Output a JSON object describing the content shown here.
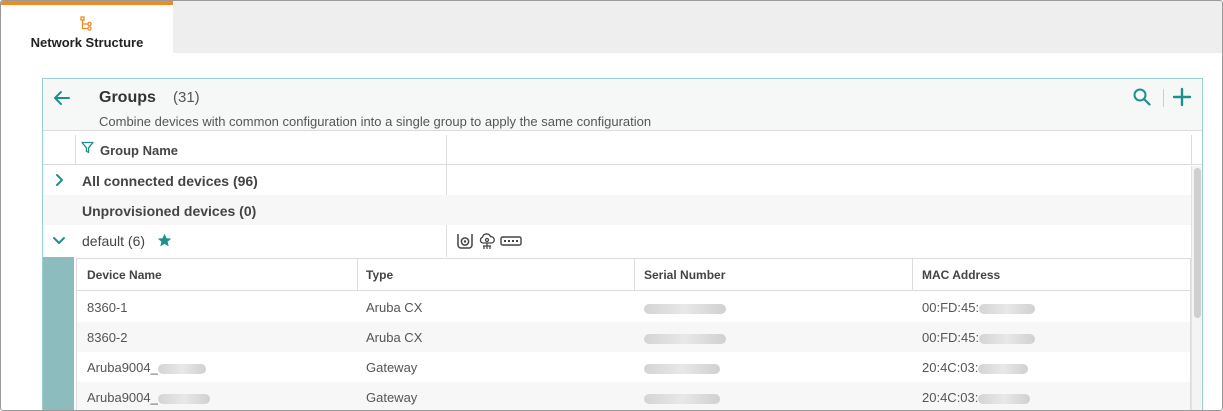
{
  "tab": {
    "label": "Network Structure",
    "accent": "#f08a24"
  },
  "panel": {
    "title": "Groups",
    "count": "(31)",
    "subtitle": "Combine devices with common configuration into a single group to apply the same configuration"
  },
  "columns": {
    "group_name": "Group Name"
  },
  "groups": [
    {
      "label": "All connected devices (96)",
      "expander": "chevron-right"
    },
    {
      "label": "Unprovisioned devices (0)"
    },
    {
      "label": "default (6)",
      "expander": "chevron-down",
      "favorite": true,
      "device_type_icons": [
        "camera-icon",
        "cloud-ap-icon",
        "switch-icon"
      ]
    }
  ],
  "device_table": {
    "headers": {
      "name": "Device Name",
      "type": "Type",
      "serial": "Serial Number",
      "mac": "MAC Address"
    },
    "rows": [
      {
        "name": "8360-1",
        "type": "Aruba CX",
        "mac": "00:FD:45:"
      },
      {
        "name": "8360-2",
        "type": "Aruba CX",
        "mac": "00:FD:45:"
      },
      {
        "name": "Aruba9004_",
        "type": "Gateway",
        "mac": "20:4C:03:"
      },
      {
        "name": "Aruba9004_",
        "type": "Gateway",
        "mac": "20:4C:03:"
      }
    ]
  },
  "colors": {
    "teal": "#1f8f8a",
    "expanded_bar": "#8cbcbd"
  }
}
